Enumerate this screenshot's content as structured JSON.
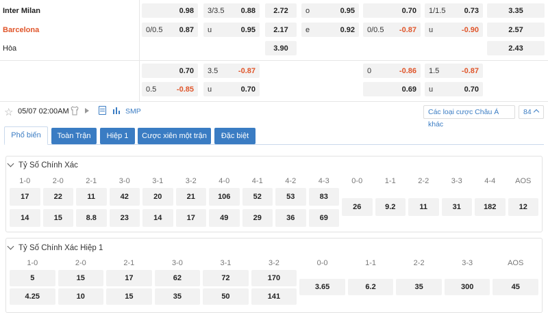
{
  "teams": {
    "home": "Inter Milan",
    "away": "Barcelona",
    "draw": "Hòa"
  },
  "odds_top": {
    "row1": {
      "h1": "0.98",
      "ou_line": "3/3.5",
      "ou_val": "0.88",
      "x12": "2.72",
      "oe_label": "o",
      "oe_val": "0.95",
      "ht_h1": "0.70",
      "ht_ou_line": "1/1.5",
      "ht_ou_val": "0.73",
      "ht_x12": "3.35"
    },
    "row2": {
      "hdp_line": "0/0.5",
      "h2": "0.87",
      "u_label": "u",
      "u_val": "0.95",
      "x12": "2.17",
      "oe_label": "e",
      "oe_val": "0.92",
      "ht_hdp_line": "0/0.5",
      "ht_h2": "-0.87",
      "ht_u_label": "u",
      "ht_u_val": "-0.90",
      "ht_x12": "2.57"
    },
    "row3": {
      "x12": "3.90",
      "ht_x12": "2.43"
    },
    "row4": {
      "h1": "0.70",
      "ou_line": "3.5",
      "ou_val": "-0.87",
      "ht_line": "0",
      "ht_h1": "-0.86",
      "ht_ou_line": "1.5",
      "ht_ou_val": "-0.87"
    },
    "row5": {
      "hdp_line": "0.5",
      "h2": "-0.85",
      "u_label": "u",
      "u_val": "0.70",
      "ht_h2": "0.69",
      "ht_u_label": "u",
      "ht_u_val": "0.70"
    }
  },
  "toolbar": {
    "datetime": "05/07 02:00AM",
    "smp": "SMP",
    "bet_types": "Các loại cược Châu Á khác",
    "count": "84"
  },
  "tabs": [
    "Phổ biến",
    "Toàn Trận",
    "Hiệp 1",
    "Cược xiên một trận",
    "Đặc biệt"
  ],
  "section1": {
    "title": "Tỷ Số Chính Xác",
    "headers": [
      "1-0",
      "2-0",
      "2-1",
      "3-0",
      "3-1",
      "3-2",
      "4-0",
      "4-1",
      "4-2",
      "4-3",
      "0-0",
      "1-1",
      "2-2",
      "3-3",
      "4-4",
      "AOS"
    ],
    "home": [
      "17",
      "22",
      "11",
      "42",
      "20",
      "21",
      "106",
      "52",
      "53",
      "83"
    ],
    "away": [
      "14",
      "15",
      "8.8",
      "23",
      "14",
      "17",
      "49",
      "29",
      "36",
      "69"
    ],
    "draw": [
      "26",
      "9.2",
      "11",
      "31",
      "182",
      "12"
    ]
  },
  "section2": {
    "title": "Tỷ Số Chính Xác Hiệp 1",
    "headers": [
      "1-0",
      "2-0",
      "2-1",
      "3-0",
      "3-1",
      "3-2",
      "0-0",
      "1-1",
      "2-2",
      "3-3",
      "AOS"
    ],
    "home": [
      "5",
      "15",
      "17",
      "62",
      "72",
      "170"
    ],
    "away": [
      "4.25",
      "10",
      "15",
      "35",
      "50",
      "141"
    ],
    "draw": [
      "3.65",
      "6.2",
      "35",
      "300",
      "45"
    ]
  }
}
